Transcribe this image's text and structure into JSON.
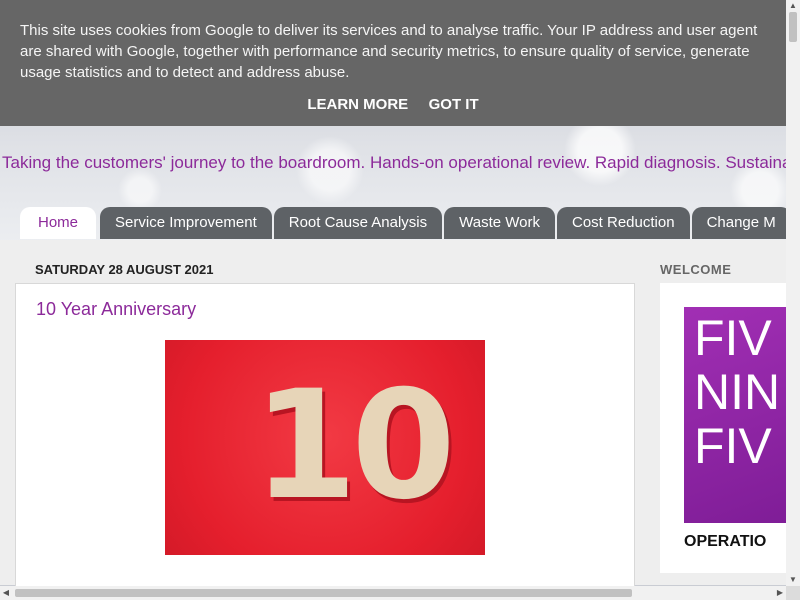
{
  "cookie": {
    "message": "This site uses cookies from Google to deliver its services and to analyse traffic. Your IP address and user agent are shared with Google, together with performance and security metrics, to ensure quality of service, generate usage statistics and to detect and address abuse.",
    "learn_more": "LEARN MORE",
    "got_it": "GOT IT"
  },
  "header": {
    "tagline": "Taking the customers' journey to the boardroom. Hands-on operational review. Rapid diagnosis. Sustainable results."
  },
  "nav": {
    "tabs": [
      "Home",
      "Service Improvement",
      "Root Cause Analysis",
      "Waste Work",
      "Cost Reduction",
      "Change M"
    ]
  },
  "post": {
    "date": "SATURDAY 28 AUGUST 2021",
    "title": "10 Year Anniversary",
    "image_text": "10"
  },
  "sidebar": {
    "title": "WELCOME",
    "logo_lines": [
      "FIV",
      "NIN",
      "FIV"
    ],
    "logo_sub": "OPERATIO"
  },
  "colors": {
    "accent": "#8c2a9a",
    "tab_bg": "#5e6266",
    "cookie_bg": "#666666",
    "image_red": "#e51f2d",
    "logo_purple": "#a12fb4"
  }
}
